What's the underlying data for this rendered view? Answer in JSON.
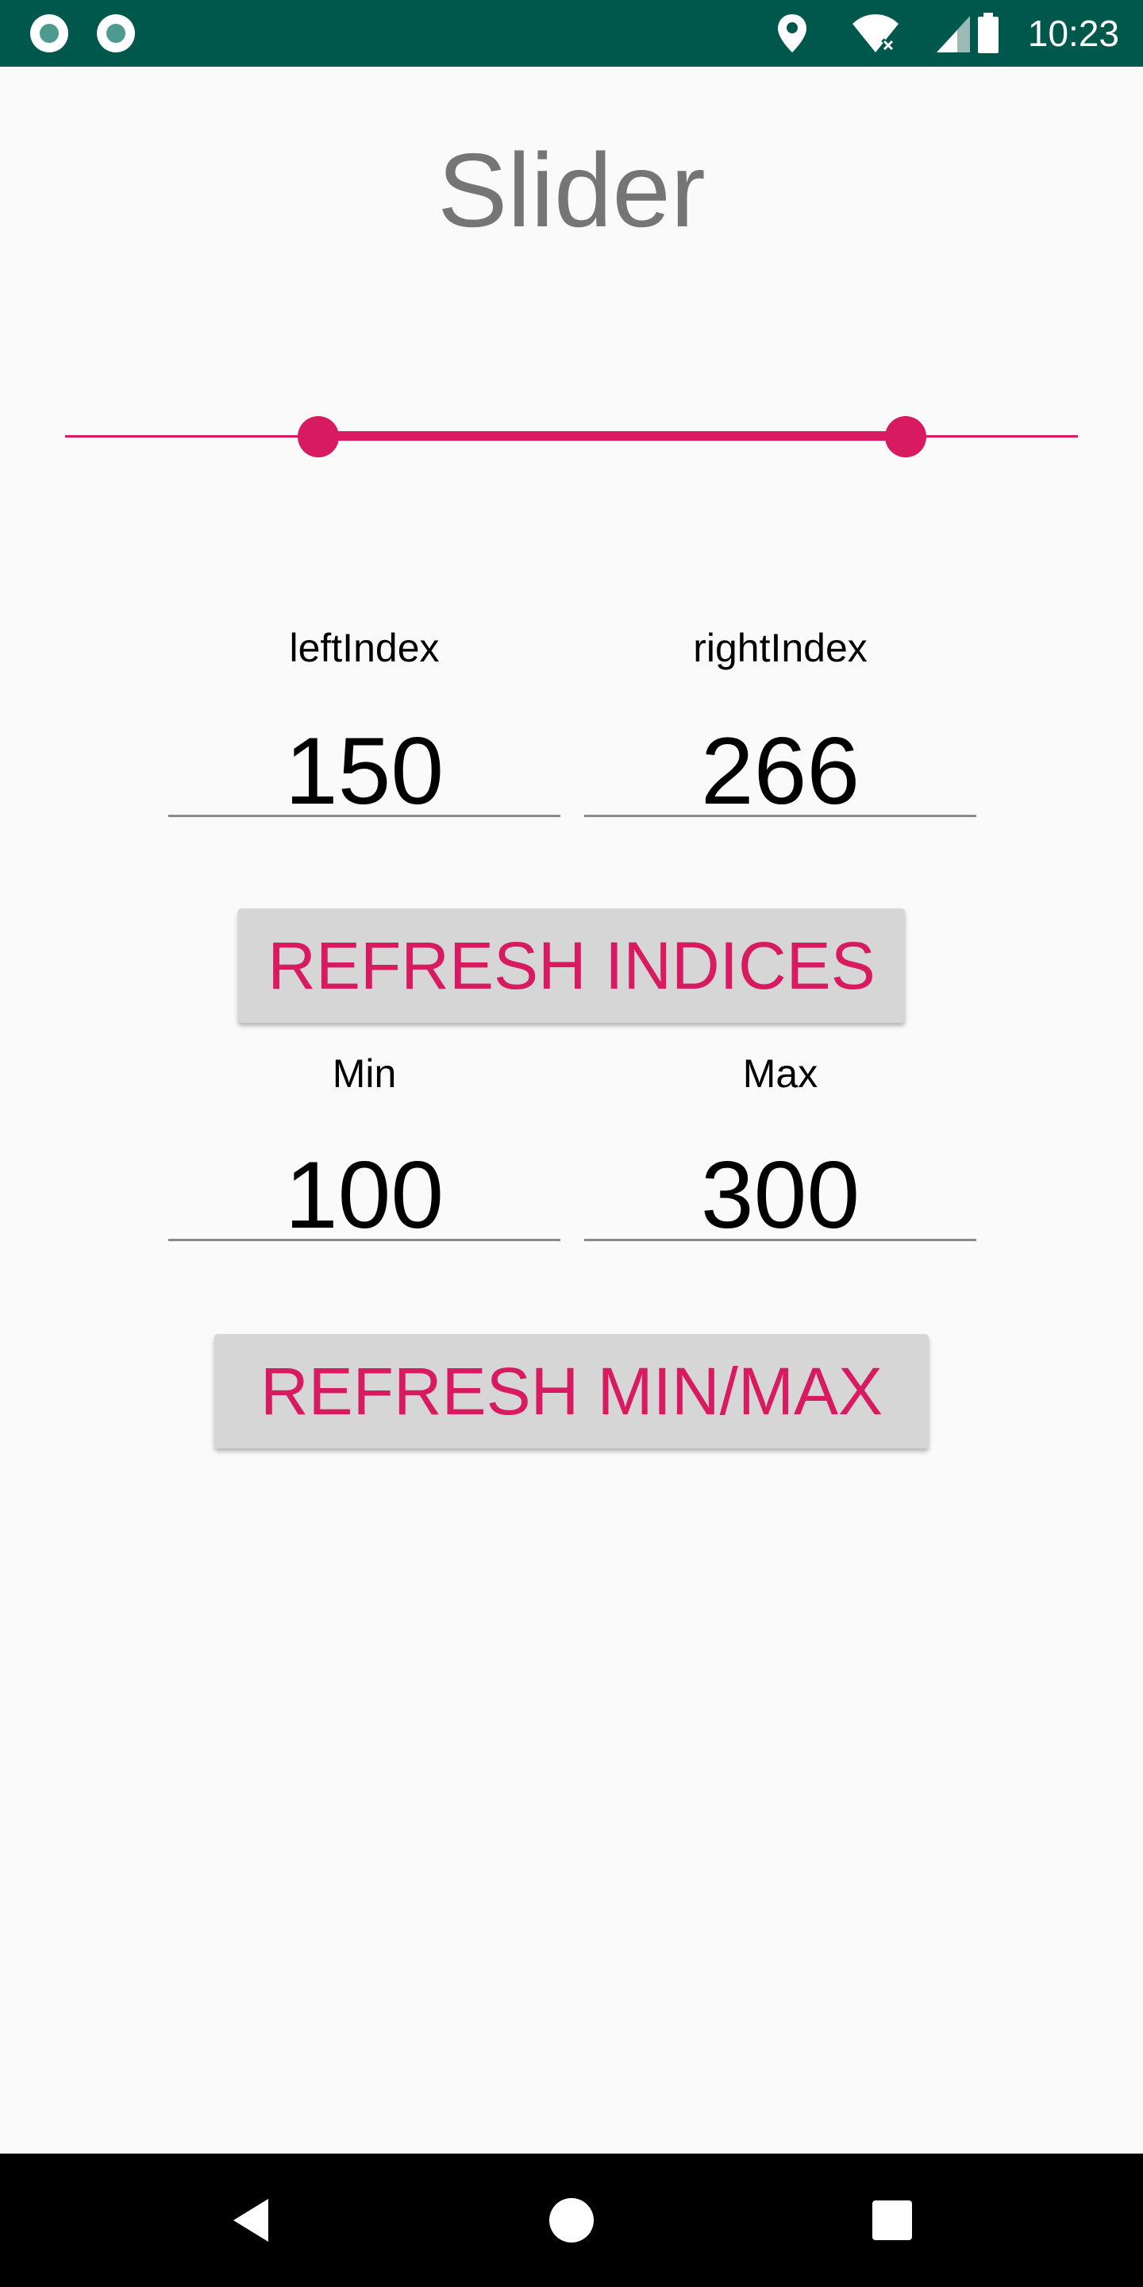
{
  "status_bar": {
    "time": "10:23",
    "icons": [
      "app-notification-icon",
      "app-notification-icon",
      "location-icon",
      "wifi-icon",
      "cell-signal-icon",
      "battery-icon"
    ]
  },
  "title": "Slider",
  "slider": {
    "min": 100,
    "max": 300,
    "left_value": 150,
    "right_value": 266,
    "color": "#d81b60"
  },
  "indices": {
    "left_label": "leftIndex",
    "left_value": "150",
    "right_label": "rightIndex",
    "right_value": "266",
    "refresh_label": "REFRESH INDICES"
  },
  "bounds": {
    "min_label": "Min",
    "min_value": "100",
    "max_label": "Max",
    "max_value": "300",
    "refresh_label": "REFRESH MIN/MAX"
  },
  "nav": {
    "back": "back-icon",
    "home": "home-icon",
    "recents": "recents-icon"
  },
  "colors": {
    "status_bar": "#00574b",
    "accent": "#d81b60",
    "background": "#fafafa",
    "button": "#d6d6d6"
  }
}
